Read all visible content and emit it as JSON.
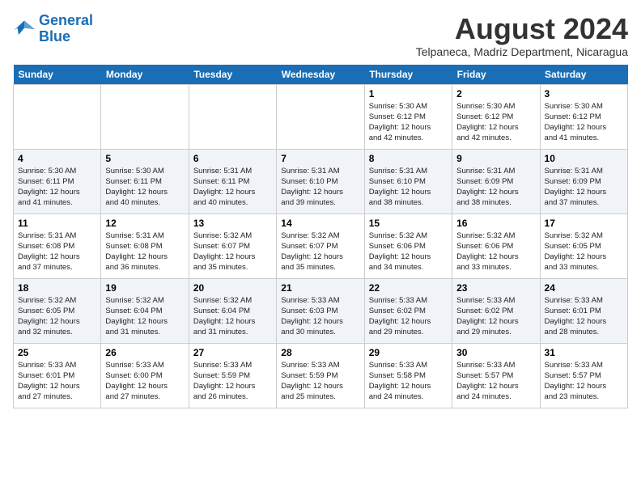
{
  "logo": {
    "line1": "General",
    "line2": "Blue"
  },
  "title": "August 2024",
  "subtitle": "Telpaneca, Madriz Department, Nicaragua",
  "days_of_week": [
    "Sunday",
    "Monday",
    "Tuesday",
    "Wednesday",
    "Thursday",
    "Friday",
    "Saturday"
  ],
  "weeks": [
    [
      {
        "day": "",
        "info": ""
      },
      {
        "day": "",
        "info": ""
      },
      {
        "day": "",
        "info": ""
      },
      {
        "day": "",
        "info": ""
      },
      {
        "day": "1",
        "info": "Sunrise: 5:30 AM\nSunset: 6:12 PM\nDaylight: 12 hours\nand 42 minutes."
      },
      {
        "day": "2",
        "info": "Sunrise: 5:30 AM\nSunset: 6:12 PM\nDaylight: 12 hours\nand 42 minutes."
      },
      {
        "day": "3",
        "info": "Sunrise: 5:30 AM\nSunset: 6:12 PM\nDaylight: 12 hours\nand 41 minutes."
      }
    ],
    [
      {
        "day": "4",
        "info": "Sunrise: 5:30 AM\nSunset: 6:11 PM\nDaylight: 12 hours\nand 41 minutes."
      },
      {
        "day": "5",
        "info": "Sunrise: 5:30 AM\nSunset: 6:11 PM\nDaylight: 12 hours\nand 40 minutes."
      },
      {
        "day": "6",
        "info": "Sunrise: 5:31 AM\nSunset: 6:11 PM\nDaylight: 12 hours\nand 40 minutes."
      },
      {
        "day": "7",
        "info": "Sunrise: 5:31 AM\nSunset: 6:10 PM\nDaylight: 12 hours\nand 39 minutes."
      },
      {
        "day": "8",
        "info": "Sunrise: 5:31 AM\nSunset: 6:10 PM\nDaylight: 12 hours\nand 38 minutes."
      },
      {
        "day": "9",
        "info": "Sunrise: 5:31 AM\nSunset: 6:09 PM\nDaylight: 12 hours\nand 38 minutes."
      },
      {
        "day": "10",
        "info": "Sunrise: 5:31 AM\nSunset: 6:09 PM\nDaylight: 12 hours\nand 37 minutes."
      }
    ],
    [
      {
        "day": "11",
        "info": "Sunrise: 5:31 AM\nSunset: 6:08 PM\nDaylight: 12 hours\nand 37 minutes."
      },
      {
        "day": "12",
        "info": "Sunrise: 5:31 AM\nSunset: 6:08 PM\nDaylight: 12 hours\nand 36 minutes."
      },
      {
        "day": "13",
        "info": "Sunrise: 5:32 AM\nSunset: 6:07 PM\nDaylight: 12 hours\nand 35 minutes."
      },
      {
        "day": "14",
        "info": "Sunrise: 5:32 AM\nSunset: 6:07 PM\nDaylight: 12 hours\nand 35 minutes."
      },
      {
        "day": "15",
        "info": "Sunrise: 5:32 AM\nSunset: 6:06 PM\nDaylight: 12 hours\nand 34 minutes."
      },
      {
        "day": "16",
        "info": "Sunrise: 5:32 AM\nSunset: 6:06 PM\nDaylight: 12 hours\nand 33 minutes."
      },
      {
        "day": "17",
        "info": "Sunrise: 5:32 AM\nSunset: 6:05 PM\nDaylight: 12 hours\nand 33 minutes."
      }
    ],
    [
      {
        "day": "18",
        "info": "Sunrise: 5:32 AM\nSunset: 6:05 PM\nDaylight: 12 hours\nand 32 minutes."
      },
      {
        "day": "19",
        "info": "Sunrise: 5:32 AM\nSunset: 6:04 PM\nDaylight: 12 hours\nand 31 minutes."
      },
      {
        "day": "20",
        "info": "Sunrise: 5:32 AM\nSunset: 6:04 PM\nDaylight: 12 hours\nand 31 minutes."
      },
      {
        "day": "21",
        "info": "Sunrise: 5:33 AM\nSunset: 6:03 PM\nDaylight: 12 hours\nand 30 minutes."
      },
      {
        "day": "22",
        "info": "Sunrise: 5:33 AM\nSunset: 6:02 PM\nDaylight: 12 hours\nand 29 minutes."
      },
      {
        "day": "23",
        "info": "Sunrise: 5:33 AM\nSunset: 6:02 PM\nDaylight: 12 hours\nand 29 minutes."
      },
      {
        "day": "24",
        "info": "Sunrise: 5:33 AM\nSunset: 6:01 PM\nDaylight: 12 hours\nand 28 minutes."
      }
    ],
    [
      {
        "day": "25",
        "info": "Sunrise: 5:33 AM\nSunset: 6:01 PM\nDaylight: 12 hours\nand 27 minutes."
      },
      {
        "day": "26",
        "info": "Sunrise: 5:33 AM\nSunset: 6:00 PM\nDaylight: 12 hours\nand 27 minutes."
      },
      {
        "day": "27",
        "info": "Sunrise: 5:33 AM\nSunset: 5:59 PM\nDaylight: 12 hours\nand 26 minutes."
      },
      {
        "day": "28",
        "info": "Sunrise: 5:33 AM\nSunset: 5:59 PM\nDaylight: 12 hours\nand 25 minutes."
      },
      {
        "day": "29",
        "info": "Sunrise: 5:33 AM\nSunset: 5:58 PM\nDaylight: 12 hours\nand 24 minutes."
      },
      {
        "day": "30",
        "info": "Sunrise: 5:33 AM\nSunset: 5:57 PM\nDaylight: 12 hours\nand 24 minutes."
      },
      {
        "day": "31",
        "info": "Sunrise: 5:33 AM\nSunset: 5:57 PM\nDaylight: 12 hours\nand 23 minutes."
      }
    ]
  ]
}
